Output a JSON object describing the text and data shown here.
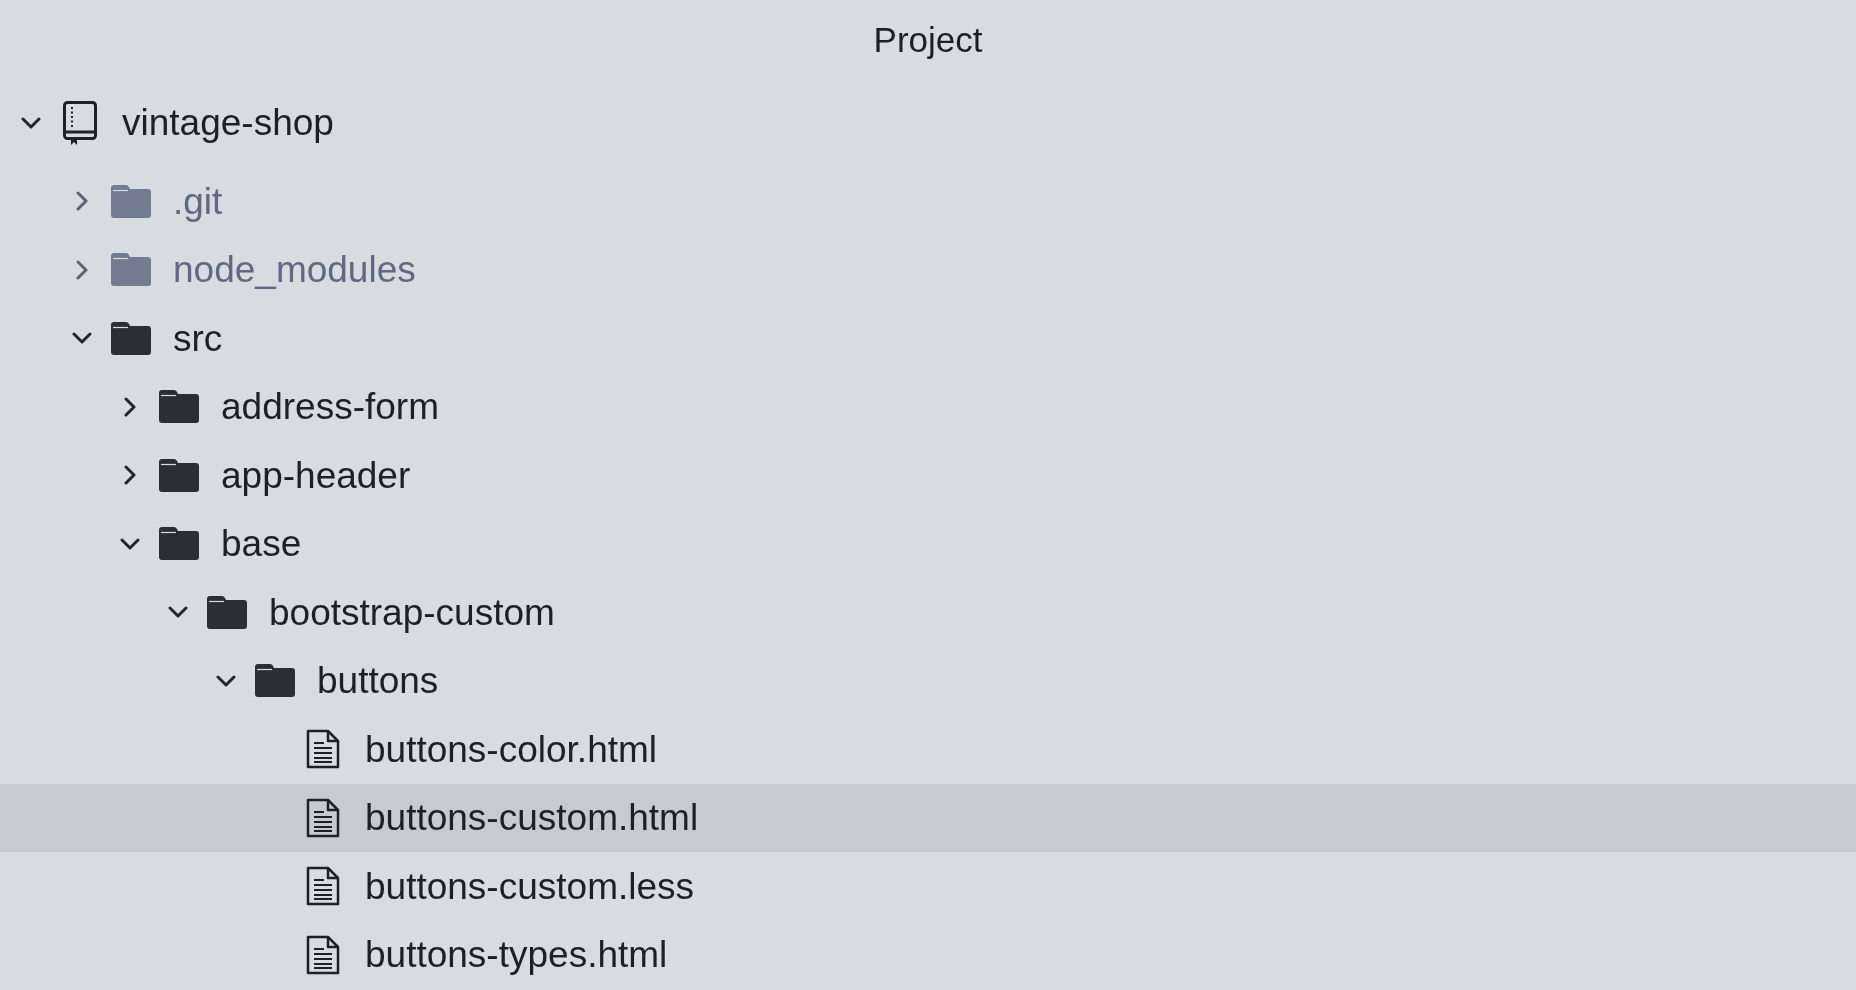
{
  "panel": {
    "title": "Project"
  },
  "tree": {
    "name": "vintage-shop",
    "kind": "project",
    "expanded": true,
    "dimmed": false,
    "selected": false,
    "children": [
      {
        "name": ".git",
        "kind": "folder",
        "expanded": false,
        "dimmed": true,
        "selected": false
      },
      {
        "name": "node_modules",
        "kind": "folder",
        "expanded": false,
        "dimmed": true,
        "selected": false
      },
      {
        "name": "src",
        "kind": "folder",
        "expanded": true,
        "dimmed": false,
        "selected": false,
        "children": [
          {
            "name": "address-form",
            "kind": "folder",
            "expanded": false,
            "dimmed": false,
            "selected": false
          },
          {
            "name": "app-header",
            "kind": "folder",
            "expanded": false,
            "dimmed": false,
            "selected": false
          },
          {
            "name": "base",
            "kind": "folder",
            "expanded": true,
            "dimmed": false,
            "selected": false,
            "children": [
              {
                "name": "bootstrap-custom",
                "kind": "folder",
                "expanded": true,
                "dimmed": false,
                "selected": false,
                "children": [
                  {
                    "name": "buttons",
                    "kind": "folder",
                    "expanded": true,
                    "dimmed": false,
                    "selected": false,
                    "children": [
                      {
                        "name": "buttons-color.html",
                        "kind": "file",
                        "dimmed": false,
                        "selected": false
                      },
                      {
                        "name": "buttons-custom.html",
                        "kind": "file",
                        "dimmed": false,
                        "selected": true
                      },
                      {
                        "name": "buttons-custom.less",
                        "kind": "file",
                        "dimmed": false,
                        "selected": false
                      },
                      {
                        "name": "buttons-types.html",
                        "kind": "file",
                        "dimmed": false,
                        "selected": false
                      }
                    ]
                  }
                ]
              }
            ]
          }
        ]
      }
    ]
  }
}
